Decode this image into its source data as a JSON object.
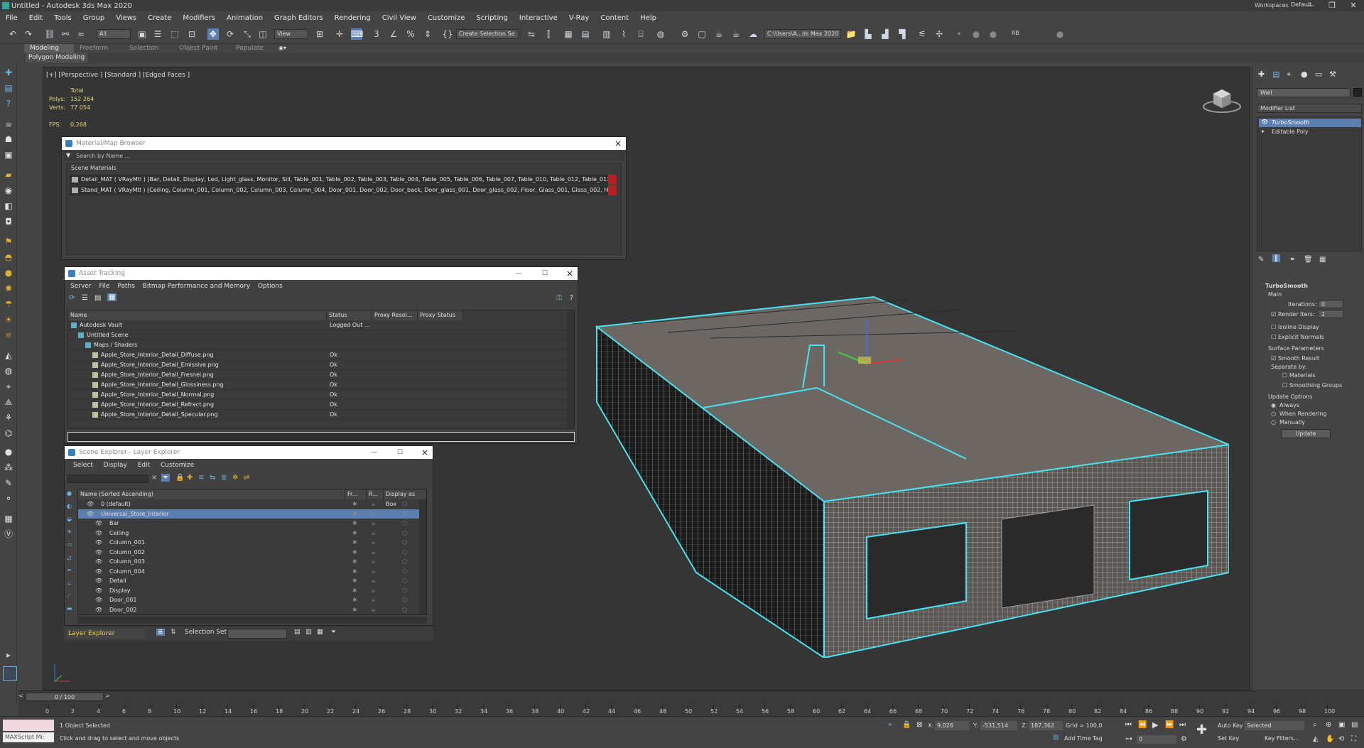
{
  "window": {
    "title": "Untitled - Autodesk 3ds Max 2020",
    "workspaces_label": "Workspaces:",
    "workspaces_value": "Default"
  },
  "menu": [
    "File",
    "Edit",
    "Tools",
    "Group",
    "Views",
    "Create",
    "Modifiers",
    "Animation",
    "Graph Editors",
    "Rendering",
    "Civil View",
    "Customize",
    "Scripting",
    "Interactive",
    "V-Ray",
    "Content",
    "Help"
  ],
  "toolbar": {
    "selection_filter": "All",
    "ref_coord": "View",
    "named_set": "Create Selection Se",
    "path": "C:\\Users\\A...ds Max 2020",
    "rb": "RB"
  },
  "ribbon": {
    "tabs": [
      "Modeling",
      "Freeform",
      "Selection",
      "Object Paint",
      "Populate"
    ],
    "active_panel": "Polygon Modeling"
  },
  "viewport": {
    "label": "[+] [Perspective ] [Standard ] [Edged Faces ]",
    "stats_total": "Total",
    "polys_label": "Polys:",
    "polys_value": "152 264",
    "verts_label": "Verts:",
    "verts_value": "77 054",
    "fps_label": "FPS:",
    "fps_value": "0,268"
  },
  "material_browser": {
    "title": "Material/Map Browser",
    "search_placeholder": "Search by Name ...",
    "section": "Scene Materials",
    "rows": [
      "Detail_MAT ( VRayMtl ) [Bar, Detail, Display, Led, Light_glass, Monitor, Sill, Table_001, Table_002, Table_003, Table_004, Table_005, Table_006, Table_007, Table_010, Table_012, Table_013, Te...",
      "Stand_MAT ( VRayMtl ) [Ceiling, Column_001, Column_002, Column_003, Column_004, Door_001, Door_002, Door_back, Door_glass_001, Door_glass_002, Floor, Glass_001, Glass_002, Handle_0..."
    ]
  },
  "asset_tracking": {
    "title": "Asset Tracking",
    "menus": [
      "Server",
      "File",
      "Paths",
      "Bitmap Performance and Memory",
      "Options"
    ],
    "columns": [
      "Name",
      "Status",
      "Proxy Resol...",
      "Proxy Status"
    ],
    "rows": [
      {
        "name": "Autodesk Vault",
        "status": "Logged Out ...",
        "indent": 0
      },
      {
        "name": "Untitled Scene",
        "status": "",
        "indent": 1
      },
      {
        "name": "Maps / Shaders",
        "status": "",
        "indent": 2
      },
      {
        "name": "Apple_Store_Interior_Detail_Diffuse.png",
        "status": "Ok",
        "indent": 3
      },
      {
        "name": "Apple_Store_Interior_Detail_Emissive.png",
        "status": "Ok",
        "indent": 3
      },
      {
        "name": "Apple_Store_Interior_Detail_Fresnel.png",
        "status": "Ok",
        "indent": 3
      },
      {
        "name": "Apple_Store_Interior_Detail_Glossiness.png",
        "status": "Ok",
        "indent": 3
      },
      {
        "name": "Apple_Store_Interior_Detail_Normal.png",
        "status": "Ok",
        "indent": 3
      },
      {
        "name": "Apple_Store_Interior_Detail_Refract.png",
        "status": "Ok",
        "indent": 3
      },
      {
        "name": "Apple_Store_Interior_Detail_Specular.png",
        "status": "Ok",
        "indent": 3
      }
    ]
  },
  "scene_explorer": {
    "title": "Scene Explorer - Layer Explorer",
    "menus": [
      "Select",
      "Display",
      "Edit",
      "Customize"
    ],
    "columns": [
      "Name (Sorted Ascending)",
      "Fr...",
      "R...",
      "Display as Box"
    ],
    "rows": [
      {
        "name": "0 (default)",
        "indent": 0,
        "selected": false
      },
      {
        "name": "Universal_Store_Interior",
        "indent": 0,
        "selected": true
      },
      {
        "name": "Bar",
        "indent": 1,
        "selected": false
      },
      {
        "name": "Ceiling",
        "indent": 1,
        "selected": false
      },
      {
        "name": "Column_001",
        "indent": 1,
        "selected": false
      },
      {
        "name": "Column_002",
        "indent": 1,
        "selected": false
      },
      {
        "name": "Column_003",
        "indent": 1,
        "selected": false
      },
      {
        "name": "Column_004",
        "indent": 1,
        "selected": false
      },
      {
        "name": "Detail",
        "indent": 1,
        "selected": false
      },
      {
        "name": "Display",
        "indent": 1,
        "selected": false
      },
      {
        "name": "Door_001",
        "indent": 1,
        "selected": false
      },
      {
        "name": "Door_002",
        "indent": 1,
        "selected": false
      }
    ],
    "layer_label": "Layer Explorer",
    "selection_set_label": "Selection Set:"
  },
  "command_panel": {
    "object_name": "Wall",
    "modifier_list": "Modifier List",
    "stack": [
      "TurboSmooth",
      "Editable Poly"
    ],
    "rollout_title": "TurboSmooth",
    "main_label": "Main",
    "iterations_label": "Iterations:",
    "iterations_value": "0",
    "render_iters_label": "Render Iters:",
    "render_iters_value": "2",
    "isoline": "Isoline Display",
    "explicit": "Explicit Normals",
    "surface_params": "Surface Parameters",
    "smooth_result": "Smooth Result",
    "separate_by": "Separate by:",
    "materials": "Materials",
    "smoothing_groups": "Smoothing Groups",
    "update_options": "Update Options",
    "always": "Always",
    "when_rendering": "When Rendering",
    "manually": "Manually",
    "update_button": "Update"
  },
  "timeline": {
    "frame": "0 / 100",
    "ticks": [
      "0",
      "2",
      "4",
      "6",
      "8",
      "10",
      "12",
      "14",
      "16",
      "18",
      "20",
      "22",
      "24",
      "26",
      "28",
      "30",
      "32",
      "34",
      "36",
      "38",
      "40",
      "42",
      "44",
      "46",
      "48",
      "50",
      "52",
      "54",
      "56",
      "58",
      "60",
      "62",
      "64",
      "66",
      "68",
      "70",
      "72",
      "74",
      "76",
      "78",
      "80",
      "82",
      "84",
      "86",
      "88",
      "90",
      "92",
      "94",
      "96",
      "98",
      "100"
    ]
  },
  "status": {
    "script_label": "MAXScript Mi:",
    "selected": "1 Object Selected",
    "hint": "Click and drag to select and move objects",
    "x_label": "X:",
    "x_value": "9,026",
    "y_label": "Y:",
    "y_value": "-531,514",
    "z_label": "Z:",
    "z_value": "187,362",
    "grid": "Grid = 100,0",
    "add_time_tag": "Add Time Tag",
    "auto_key": "Auto Key",
    "set_key": "Set Key",
    "selected_dropdown": "Selected",
    "key_filters": "Key Filters...",
    "frame_field": "0"
  },
  "colors": {
    "accent": "#5d7fb0",
    "wire": "#46e3ef",
    "stats": "#e5d57a",
    "bg": "#444444"
  }
}
